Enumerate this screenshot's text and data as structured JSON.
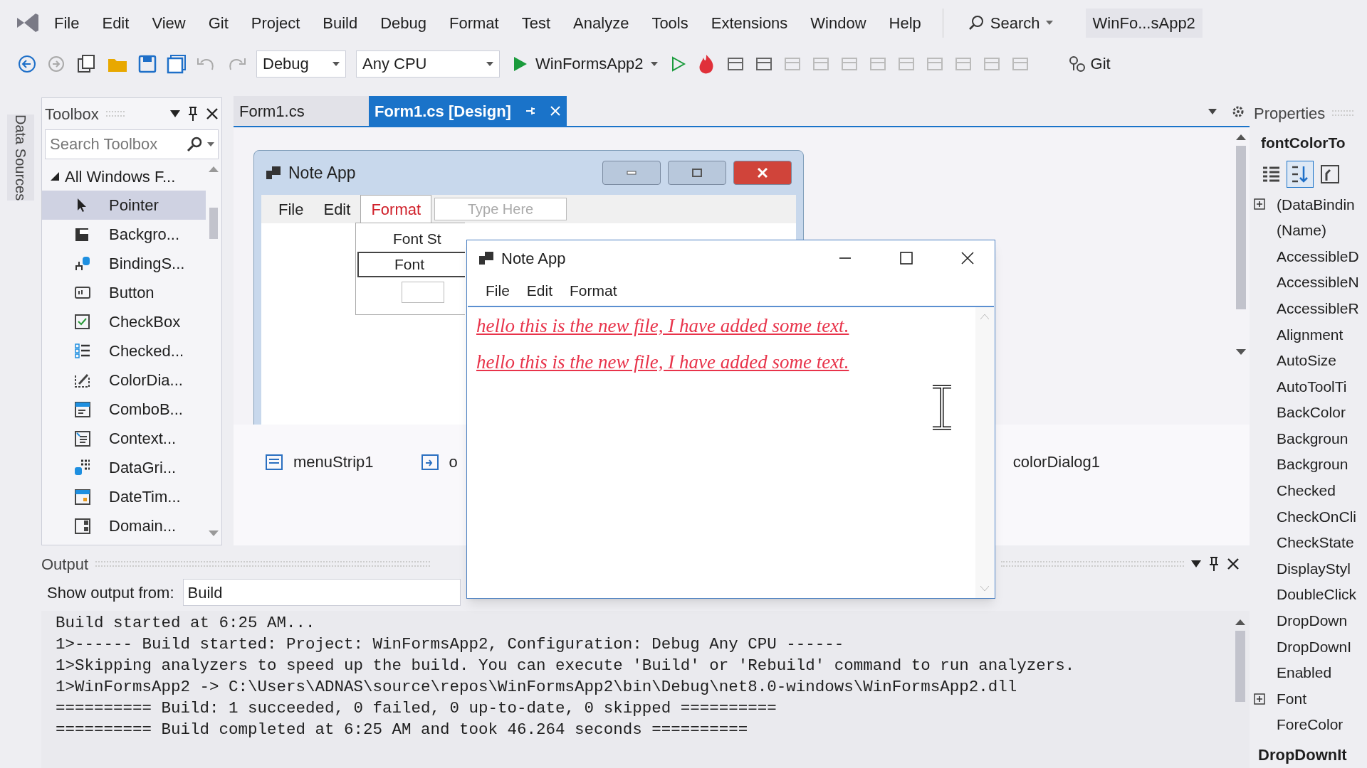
{
  "menu_bar": {
    "items": [
      "File",
      "Edit",
      "View",
      "Git",
      "Project",
      "Build",
      "Debug",
      "Format",
      "Test",
      "Analyze",
      "Tools",
      "Extensions",
      "Window",
      "Help"
    ],
    "search": "Search",
    "solution_name": "WinFo...sApp2"
  },
  "toolbar": {
    "configuration": "Debug",
    "platform": "Any CPU",
    "start_project": "WinFormsApp2",
    "git": "Git"
  },
  "side_tab": "Data Sources",
  "toolbox": {
    "title": "Toolbox",
    "search_placeholder": "Search Toolbox",
    "group": {
      "label": "All Windows F...",
      "expanded": true
    },
    "items": [
      {
        "label": "Pointer",
        "selected": true
      },
      {
        "label": "Backgro...",
        "selected": false
      },
      {
        "label": "BindingS...",
        "selected": false
      },
      {
        "label": "Button",
        "selected": false
      },
      {
        "label": "CheckBox",
        "selected": false
      },
      {
        "label": "Checked...",
        "selected": false
      },
      {
        "label": "ColorDia...",
        "selected": false
      },
      {
        "label": "ComboB...",
        "selected": false
      },
      {
        "label": "Context...",
        "selected": false
      },
      {
        "label": "DataGri...",
        "selected": false
      },
      {
        "label": "DateTim...",
        "selected": false
      },
      {
        "label": "Domain...",
        "selected": false
      }
    ]
  },
  "document_tabs": [
    {
      "label": "Form1.cs",
      "selected": false
    },
    {
      "label": "Form1.cs [Design]",
      "selected": true
    }
  ],
  "designer_form": {
    "title": "Note App",
    "menu": [
      {
        "label": "File",
        "selected": false
      },
      {
        "label": "Edit",
        "selected": false
      },
      {
        "label": "Format",
        "selected": true
      }
    ],
    "placeholder": "Type Here",
    "dropdown_items": [
      "Font St",
      "Font"
    ]
  },
  "component_tray": [
    "menuStrip1",
    "o",
    "colorDialog1"
  ],
  "running_app": {
    "title": "Note App",
    "menu": [
      "File",
      "Edit",
      "Format"
    ],
    "lines": [
      "hello this is the new file, I have added some text.",
      "hello this is the new file, I have added some text."
    ]
  },
  "output": {
    "title": "Output",
    "source_label": "Show output from:",
    "source": "Build",
    "lines": [
      "Build started at 6:25 AM...",
      "1>------ Build started: Project: WinFormsApp2, Configuration: Debug Any CPU ------",
      "1>Skipping analyzers to speed up the build. You can execute 'Build' or 'Rebuild' command to run analyzers.",
      "1>WinFormsApp2 -> C:\\Users\\ADNAS\\source\\repos\\WinFormsApp2\\bin\\Debug\\net8.0-windows\\WinFormsApp2.dll",
      "========== Build: 1 succeeded, 0 failed, 0 up-to-date, 0 skipped ==========",
      "========== Build completed at 6:25 AM and took 46.264 seconds =========="
    ]
  },
  "properties": {
    "title": "Properties",
    "object": "fontColorTo",
    "rows": [
      {
        "name": "(DataBindin",
        "expandable": true
      },
      {
        "name": "(Name)",
        "expandable": false
      },
      {
        "name": "AccessibleD",
        "expandable": false
      },
      {
        "name": "AccessibleN",
        "expandable": false
      },
      {
        "name": "AccessibleR",
        "expandable": false
      },
      {
        "name": "Alignment",
        "expandable": false
      },
      {
        "name": "AutoSize",
        "expandable": false
      },
      {
        "name": "AutoToolTi",
        "expandable": false
      },
      {
        "name": "BackColor",
        "expandable": false
      },
      {
        "name": "Backgroun",
        "expandable": false
      },
      {
        "name": "Backgroun",
        "expandable": false
      },
      {
        "name": "Checked",
        "expandable": false
      },
      {
        "name": "CheckOnCli",
        "expandable": false
      },
      {
        "name": "CheckState",
        "expandable": false
      },
      {
        "name": "DisplayStyl",
        "expandable": false
      },
      {
        "name": "DoubleClick",
        "expandable": false
      },
      {
        "name": "DropDown",
        "expandable": false
      },
      {
        "name": "DropDownI",
        "expandable": false
      },
      {
        "name": "Enabled",
        "expandable": false
      },
      {
        "name": "Font",
        "expandable": true
      },
      {
        "name": "ForeColor",
        "expandable": false
      }
    ],
    "description_title": "DropDownIt"
  }
}
